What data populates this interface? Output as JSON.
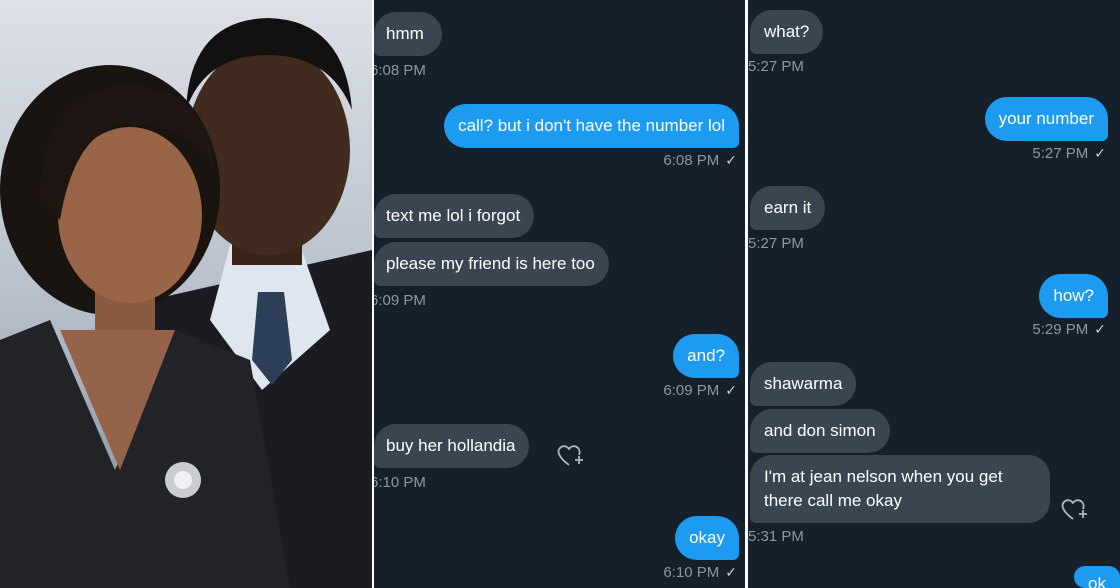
{
  "photo": {
    "description_icon": "couple-photo"
  },
  "conversation_a": {
    "messages": [
      {
        "direction": "recv",
        "text": "hmm",
        "time": "6:08 PM"
      },
      {
        "direction": "sent",
        "text": "call? but i don't have the number lol",
        "time": "6:08 PM"
      },
      {
        "direction": "recv",
        "text": "text me lol i forgot"
      },
      {
        "direction": "recv",
        "text": "please my friend is here too",
        "time": "6:09 PM"
      },
      {
        "direction": "sent",
        "text": "and?",
        "time": "6:09 PM"
      },
      {
        "direction": "recv",
        "text": "buy her hollandia",
        "time": "6:10 PM"
      },
      {
        "direction": "sent",
        "text": "okay",
        "time": "6:10 PM"
      }
    ]
  },
  "conversation_b": {
    "messages": [
      {
        "direction": "recv",
        "text": "what?",
        "time": "5:27 PM"
      },
      {
        "direction": "sent",
        "text": "your number",
        "time": "5:27 PM"
      },
      {
        "direction": "recv",
        "text": "earn it",
        "time": "5:27 PM"
      },
      {
        "direction": "sent",
        "text": "how?",
        "time": "5:29 PM"
      },
      {
        "direction": "recv",
        "text": "shawarma"
      },
      {
        "direction": "recv",
        "text": "and don simon"
      },
      {
        "direction": "recv",
        "text": "I'm at jean nelson when you get there call me okay",
        "time": "5:31 PM"
      },
      {
        "direction": "sent",
        "text": "ok"
      }
    ]
  },
  "icons": {
    "read_receipt": "check-icon",
    "react": "heart-plus-icon"
  },
  "colors": {
    "background": "#15202b",
    "sent": "#1d9bf0",
    "received": "#3a4552",
    "timestamp": "#8899a6"
  }
}
